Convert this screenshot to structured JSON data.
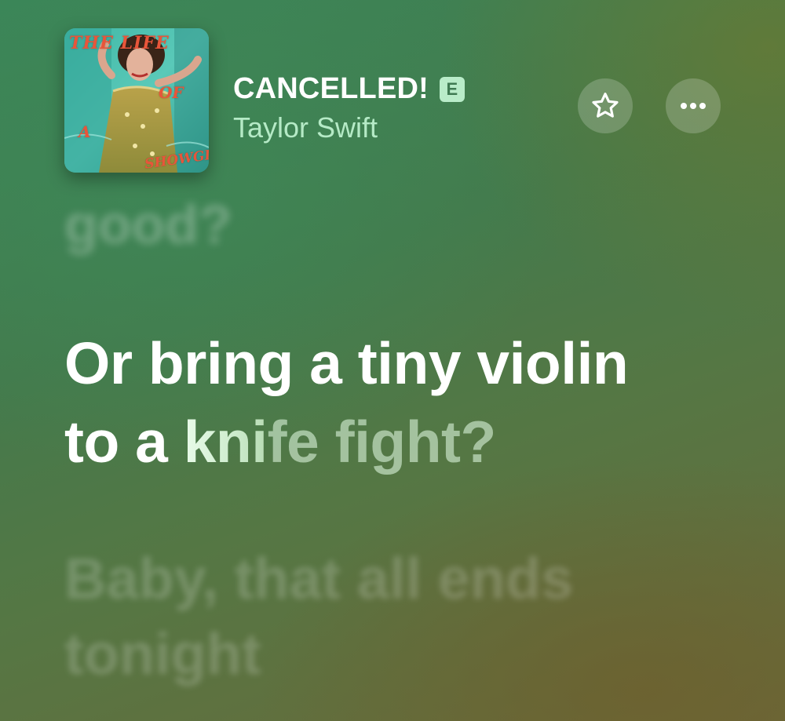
{
  "now_playing": {
    "cover_text": {
      "line1": "THE LIFE",
      "line2": "OF",
      "line3": "A",
      "line4": "SHOWGIRL"
    },
    "title": "CANCELLED!",
    "explicit_label": "E",
    "artist": "Taylor Swift",
    "favorite_icon": "star-icon",
    "more_icon": "ellipsis-icon"
  },
  "lyrics": {
    "previous": "good?",
    "current": {
      "line1": "Or bring a tiny violin",
      "line2_sung": "to a ",
      "line2_active": "kni",
      "line2_upcoming": "fe fight?"
    },
    "next": {
      "line1": "Baby, that all ends",
      "line2": "tonight"
    }
  },
  "colors": {
    "background_top": "#3b8558",
    "background_bottom": "#6a6a3a",
    "artist_text": "#b5eac6",
    "explicit_badge": "#b9ecc9"
  }
}
